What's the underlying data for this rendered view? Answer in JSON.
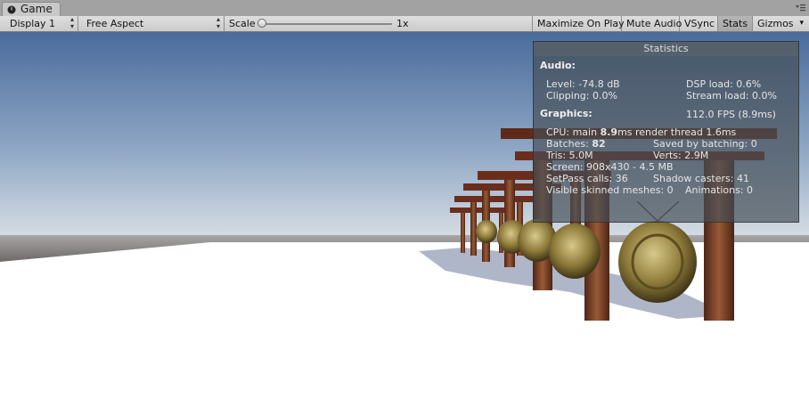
{
  "window": {
    "tab_label": "Game",
    "tab_icon": "game-controller-icon",
    "menu_icon": "panel-menu-icon"
  },
  "toolbar": {
    "display": "Display 1",
    "aspect": "Free Aspect",
    "scale_label": "Scale",
    "scale_value": "1x",
    "maximize": "Maximize On Play",
    "mute": "Mute Audio",
    "vsync": "VSync",
    "stats": "Stats",
    "gizmos": "Gizmos",
    "gizmos_dropdown_icon": "caret-down-icon"
  },
  "stats": {
    "title": "Statistics",
    "audio_heading": "Audio:",
    "level": "Level: -74.8 dB",
    "dsp": "DSP load: 0.6%",
    "clipping": "Clipping: 0.0%",
    "stream": "Stream load: 0.0%",
    "graphics_heading": "Graphics:",
    "fps": "112.0 FPS (8.9ms)",
    "cpu_prefix": "CPU: main ",
    "cpu_main": "8.9",
    "cpu_suffix": "ms  render thread 1.6ms",
    "batches_prefix": "Batches: ",
    "batches_value": "82",
    "saved": "Saved by batching: 0",
    "tris": "Tris: 5.0M",
    "verts": "Verts: 2.9M",
    "screen": "Screen: 908x430 - 4.5 MB",
    "setpass": "SetPass calls: 36",
    "shadow": "Shadow casters: 41",
    "skinned": "Visible skinned meshes: 0",
    "animations": "Animations: 0"
  },
  "colors": {
    "sky_top": "#4d6fa0",
    "sky_horizon": "#c3cfdc",
    "ground": "#ffffff",
    "pillar": "#7a3c26",
    "gong": "#8d7a3a",
    "stats_bg": "#4a525a"
  }
}
